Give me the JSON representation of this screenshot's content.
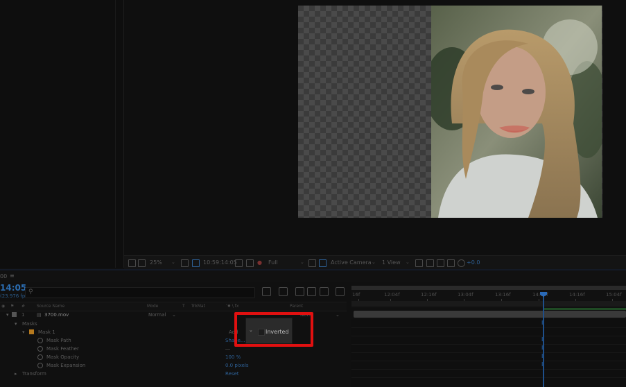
{
  "viewer_toolbar": {
    "zoom": "25%",
    "timecode": "10:59:14:05",
    "resolution": "Full",
    "view": "Active Camera",
    "views": "1 View",
    "exposure": "+0.0"
  },
  "timeline": {
    "tab_label": "00",
    "timecode": "14:05",
    "frames": "(23.976 fps)",
    "columns": {
      "source_name": "Source Name",
      "mode": "Mode",
      "t": "T",
      "trkmat": "TrkMat",
      "switches": "’✹ \\ fx",
      "parent": "Parent"
    },
    "ruler_labels": [
      "16f",
      "12:04f",
      "12:16f",
      "13:04f",
      "13:16f",
      "14:04f",
      "14:16f",
      "15:04f"
    ],
    "layer": {
      "number": "1",
      "name": "3700.mov",
      "mode": "Normal",
      "parent": "None"
    },
    "properties": [
      {
        "label": "Masks",
        "value": ""
      },
      {
        "label": "Mask 1",
        "value": "Add"
      },
      {
        "label": "Mask Path",
        "value": "Shape..."
      },
      {
        "label": "Mask Feather",
        "value": "―"
      },
      {
        "label": "Mask Opacity",
        "value": "100 %"
      },
      {
        "label": "Mask Expansion",
        "value": "0.0 pixels"
      },
      {
        "label": "Transform",
        "value": "Reset"
      }
    ]
  },
  "popup": {
    "inverted_label": "Inverted",
    "inverted_checked": false
  },
  "colors": {
    "timecode_blue": "#2b6cb0",
    "highlight_red": "#e01010"
  }
}
